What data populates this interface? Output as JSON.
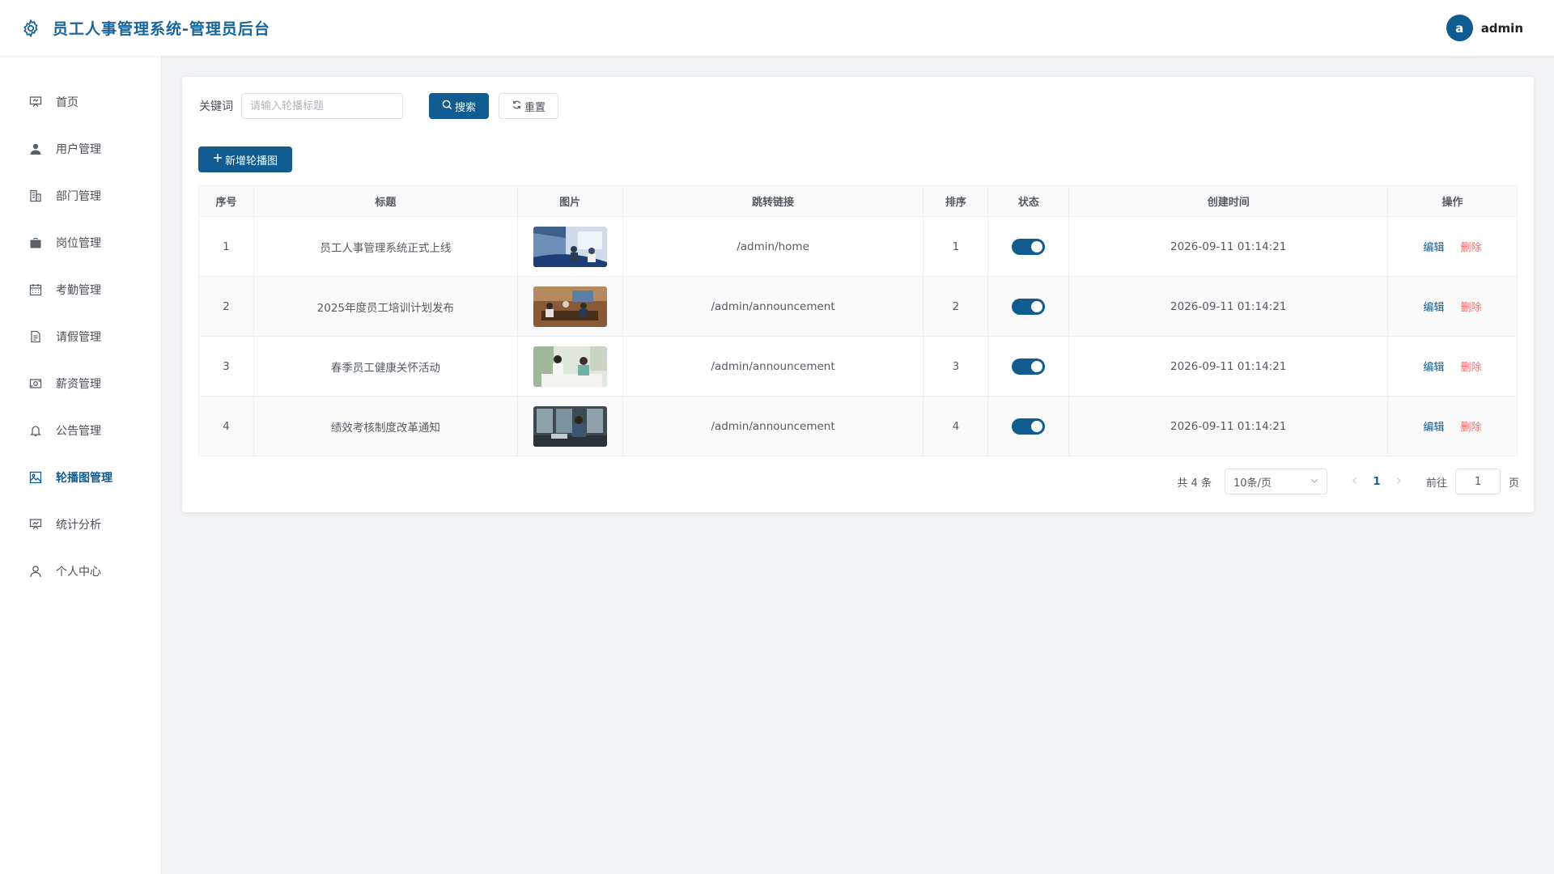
{
  "header": {
    "title": "员工人事管理系统-管理员后台",
    "avatar_letter": "a",
    "username": "admin"
  },
  "sidebar": {
    "items": [
      {
        "label": "首页",
        "icon": "presentation-icon"
      },
      {
        "label": "用户管理",
        "icon": "user-icon"
      },
      {
        "label": "部门管理",
        "icon": "building-icon"
      },
      {
        "label": "岗位管理",
        "icon": "briefcase-icon"
      },
      {
        "label": "考勤管理",
        "icon": "calendar-icon"
      },
      {
        "label": "请假管理",
        "icon": "document-icon"
      },
      {
        "label": "薪资管理",
        "icon": "money-icon"
      },
      {
        "label": "公告管理",
        "icon": "bell-icon"
      },
      {
        "label": "轮播图管理",
        "icon": "picture-icon",
        "active": true
      },
      {
        "label": "统计分析",
        "icon": "chart-icon"
      },
      {
        "label": "个人中心",
        "icon": "person-icon"
      }
    ]
  },
  "search": {
    "label": "关键词",
    "placeholder": "请输入轮播标题",
    "value": "",
    "search_button": "搜索",
    "reset_button": "重置"
  },
  "toolbar": {
    "add_button": "新增轮播图"
  },
  "table": {
    "columns": [
      "序号",
      "标题",
      "图片",
      "跳转链接",
      "排序",
      "状态",
      "创建时间",
      "操作"
    ],
    "rows": [
      {
        "index": "1",
        "title": "员工人事管理系统正式上线",
        "link": "/admin/home",
        "sort": "1",
        "enabled": true,
        "created": "2026-09-11 01:14:21",
        "edit": "编辑",
        "delete": "删除"
      },
      {
        "index": "2",
        "title": "2025年度员工培训计划发布",
        "link": "/admin/announcement",
        "sort": "2",
        "enabled": true,
        "created": "2026-09-11 01:14:21",
        "edit": "编辑",
        "delete": "删除"
      },
      {
        "index": "3",
        "title": "春季员工健康关怀活动",
        "link": "/admin/announcement",
        "sort": "3",
        "enabled": true,
        "created": "2026-09-11 01:14:21",
        "edit": "编辑",
        "delete": "删除"
      },
      {
        "index": "4",
        "title": "绩效考核制度改革通知",
        "link": "/admin/announcement",
        "sort": "4",
        "enabled": true,
        "created": "2026-09-11 01:14:21",
        "edit": "编辑",
        "delete": "删除"
      }
    ]
  },
  "pagination": {
    "total_text": "共 4 条",
    "page_size": "10条/页",
    "current_page": "1",
    "goto_label": "前往",
    "goto_value": "1",
    "page_suffix": "页"
  },
  "colors": {
    "primary": "#105b8f",
    "danger": "#f56c6c"
  }
}
